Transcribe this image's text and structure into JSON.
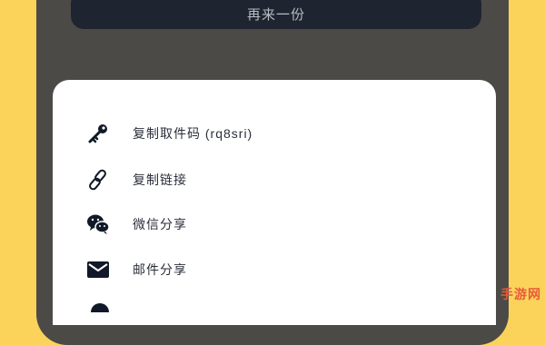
{
  "top_button": {
    "label": "再来一份"
  },
  "menu": {
    "items": [
      {
        "label": "复制取件码 (rq8sri)",
        "icon": "key-icon"
      },
      {
        "label": "复制链接",
        "icon": "link-icon"
      },
      {
        "label": "微信分享",
        "icon": "wechat-icon"
      },
      {
        "label": "邮件分享",
        "icon": "mail-icon"
      }
    ]
  },
  "watermark": {
    "text": "手游网"
  },
  "colors": {
    "background": "#fbd35a",
    "phone_frame": "#4c4a47",
    "top_button": "#1f2530",
    "sheet": "#ffffff",
    "icon": "#111827",
    "text": "#2b2f3a"
  }
}
